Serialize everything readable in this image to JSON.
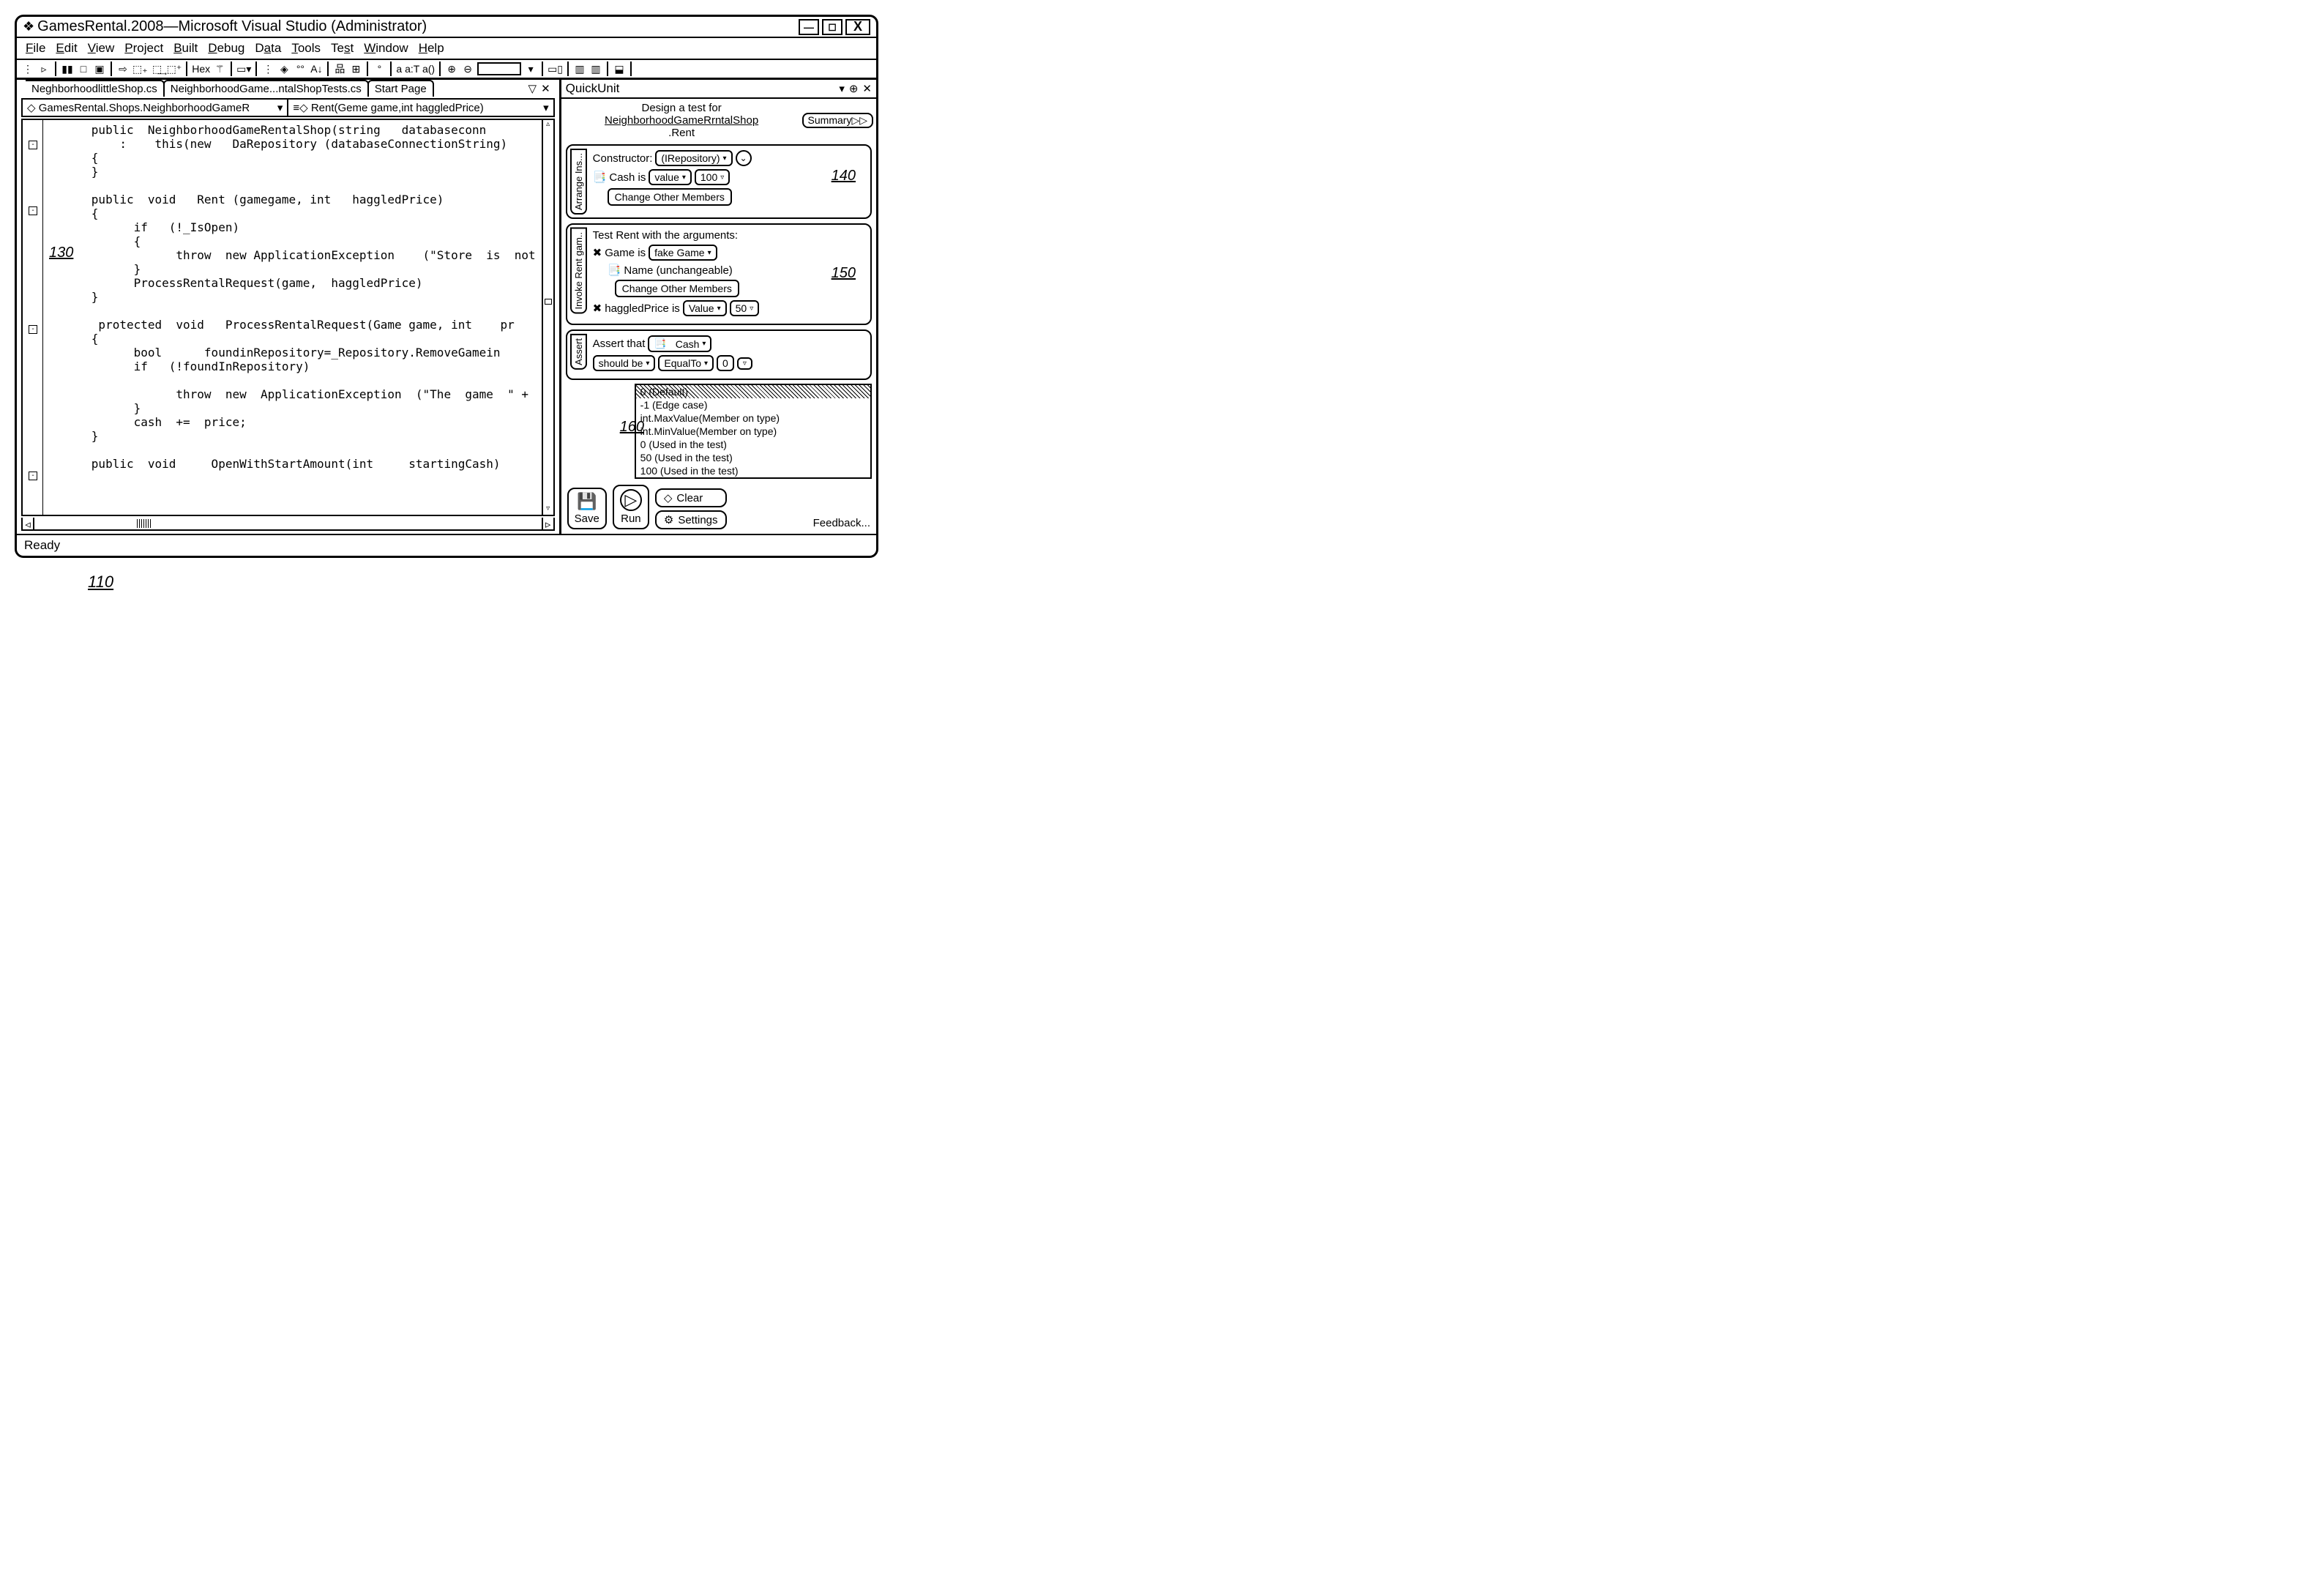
{
  "title": "GamesRental.2008—Microsoft Visual Studio (Administrator)",
  "menu": {
    "file": "File",
    "edit": "Edit",
    "view": "View",
    "project": "Project",
    "built": "Built",
    "debug": "Debug",
    "data": "Data",
    "tools": "Tools",
    "test": "Test",
    "window": "Window",
    "help": "Help"
  },
  "toolbar": {
    "hex": "Hex",
    "text_group": "a a:T a()"
  },
  "tabs": {
    "t1": "NeghborhoodlittleShop.cs",
    "t2": "NeighborhoodGame...ntalShopTests.cs",
    "t3": "Start Page"
  },
  "nav": {
    "left": "GamesRental.Shops.NeighborhoodGameR",
    "right": "Rent(Geme game,int haggledPrice)"
  },
  "code": "      public  NeighborhoodGameRentalShop(string   databaseconn\n          :    this(new   DaRepository (databaseConnectionString)\n      {\n      }\n\n      public  void   Rent (gamegame, int   haggledPrice)\n      {\n            if   (!_IsOpen)\n            {\n                  throw  new ApplicationException    (\"Store  is  not\n            }\n            ProcessRentalRequest(game,  haggledPrice)\n      }\n\n       protected  void   ProcessRentalRequest(Game game, int    pr\n      {\n            bool      foundinRepository=_Repository.RemoveGamein\n            if   (!foundInRepository)\n\n                  throw  new  ApplicationException  (\"The  game  \" +\n            }\n            cash  +=  price;\n      }\n\n      public  void     OpenWithStartAmount(int     startingCash)",
  "callouts": {
    "c130": "130",
    "c110": "110"
  },
  "quickunit": {
    "title": "QuickUnit",
    "design_prefix": "Design a test for",
    "design_method": "NeighborhoodGameRrntalShop",
    "design_sub": ".Rent",
    "summary": "Summary",
    "arrange": {
      "tab": "Arrange Ins...",
      "constructor_lbl": "Constructor:",
      "constructor_val": "(IRepository)",
      "cash_lbl": "Cash is",
      "cash_mode": "value",
      "cash_val": "100",
      "change": "Change Other Members",
      "callout": "140"
    },
    "invoke": {
      "tab": "Invoke Rent gam..",
      "heading": "Test Rent with the arguments:",
      "game_lbl": "Game is",
      "game_val": "fake Game",
      "name_lbl": "Name  (unchangeable)",
      "change": "Change Other Members",
      "haggled_lbl": "haggledPrice is",
      "haggled_mode": "Value",
      "haggled_val": "50",
      "callout": "150"
    },
    "assert": {
      "tab": "Assert",
      "that": "Assert that",
      "cash": "Cash",
      "should": "should be",
      "equal": "EqualTo",
      "val": "0"
    },
    "suggestions": {
      "r0": "0 (Default)",
      "r1": "-1 (Edge case)",
      "r2": "int.MaxValue(Member on type)",
      "r3": "int.MinValue(Member on type)",
      "r4": "0 (Used in the test)",
      "r5": "50 (Used in the test)",
      "r6": "100 (Used in the test)",
      "callout": "160"
    },
    "actions": {
      "save": "Save",
      "run": "Run",
      "clear": "Clear",
      "settings": "Settings",
      "feedback": "Feedback..."
    }
  },
  "status": "Ready"
}
